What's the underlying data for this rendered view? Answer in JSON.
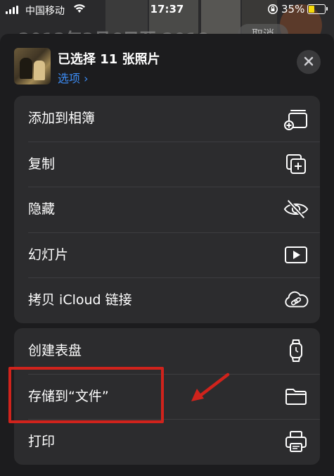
{
  "status_bar": {
    "carrier": "中国移动",
    "time": "17:37",
    "battery_percent": "35%",
    "battery_level": 0.35
  },
  "background": {
    "title": "2013年3月6日至 2018",
    "cancel_label": "取消"
  },
  "sheet": {
    "title": "已选择 11 张照片",
    "options_label": "选项 ›",
    "close_icon": "xmark-icon",
    "group1": [
      {
        "label": "添加到相簿",
        "icon": "add-album-icon"
      },
      {
        "label": "复制",
        "icon": "duplicate-icon"
      },
      {
        "label": "隐藏",
        "icon": "eye-slash-icon"
      },
      {
        "label": "幻灯片",
        "icon": "slideshow-icon"
      },
      {
        "label": "拷贝 iCloud 链接",
        "icon": "link-cloud-icon"
      }
    ],
    "group2": [
      {
        "label": "创建表盘",
        "icon": "watch-icon"
      },
      {
        "label": "存储到“文件”",
        "icon": "folder-icon"
      },
      {
        "label": "打印",
        "icon": "printer-icon"
      }
    ]
  },
  "colors": {
    "accent": "#3c8cf5",
    "annotation": "#d0231c",
    "sheet_bg": "#1c1c1e",
    "row_bg": "#2c2c2e"
  }
}
